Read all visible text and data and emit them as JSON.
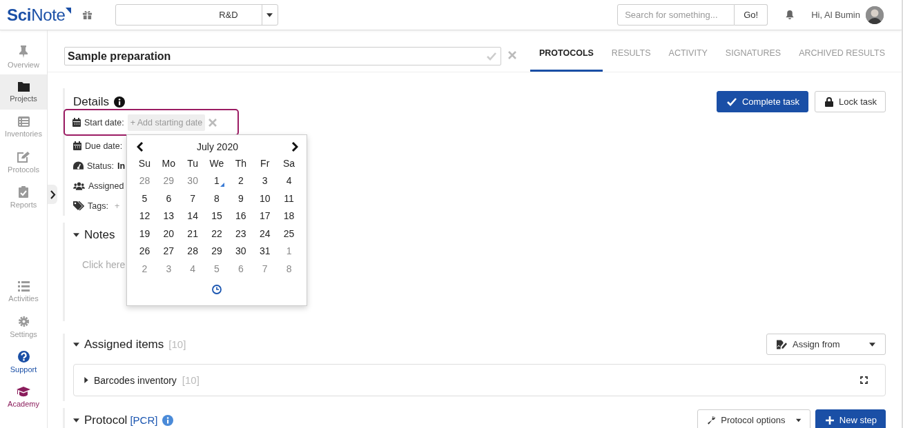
{
  "header": {
    "logo": "**Sci**Note",
    "team": "R&D",
    "search": {
      "placeholder": "Search for something...",
      "button": "Go!"
    },
    "greeting": "Hi, Al Bumin"
  },
  "sidebar": {
    "items": [
      {
        "label": "Overview",
        "selected": false,
        "color": "#9a9a9a"
      },
      {
        "label": "Projects",
        "selected": true,
        "color": "#555555"
      },
      {
        "label": "Inventories",
        "selected": false,
        "color": "#9a9a9a"
      },
      {
        "label": "Protocols",
        "selected": false,
        "color": "#9a9a9a"
      },
      {
        "label": "Reports",
        "selected": false,
        "color": "#9a9a9a"
      }
    ],
    "bottom_items": [
      {
        "label": "Activities",
        "selected": false,
        "color": "#9a9a9a"
      },
      {
        "label": "Settings",
        "selected": false,
        "color": "#9a9a9a"
      },
      {
        "label": "Support",
        "selected": false,
        "color": "#1a4fa6"
      },
      {
        "label": "Academy",
        "selected": false,
        "color": "#8b1d5c"
      }
    ]
  },
  "task": {
    "title": "Sample preparation",
    "tabs": [
      {
        "label": "PROTOCOLS",
        "selected": true
      },
      {
        "label": "RESULTS",
        "selected": false
      },
      {
        "label": "ACTIVITY",
        "selected": false
      },
      {
        "label": "SIGNATURES",
        "selected": false
      },
      {
        "label": "ARCHIVED RESULTS",
        "selected": false
      }
    ]
  },
  "details": {
    "heading": "Details",
    "buttons": [
      {
        "label": "Complete task",
        "kind": "primary"
      },
      {
        "label": "Lock task",
        "kind": "default"
      }
    ],
    "fields": [
      {
        "label": "Start date:",
        "value": "+ Add starting date",
        "kind": "chip",
        "highlighted": true
      },
      {
        "label": "Due date:",
        "kind": "plain",
        "highlighted": false
      },
      {
        "label": "Status:",
        "value": "In",
        "kind": "plain",
        "highlighted": false
      },
      {
        "label": "Assigned",
        "kind": "plain",
        "highlighted": false
      },
      {
        "label": "Tags:",
        "value": "+",
        "kind": "add",
        "highlighted": false
      }
    ]
  },
  "datepicker": {
    "month": "July 2020",
    "weekdays": [
      "Su",
      "Mo",
      "Tu",
      "We",
      "Th",
      "Fr",
      "Sa"
    ],
    "days": [
      {
        "label": "28",
        "other_month": true,
        "today": false
      },
      {
        "label": "29",
        "other_month": true,
        "today": false
      },
      {
        "label": "30",
        "other_month": true,
        "today": false
      },
      {
        "label": "1",
        "other_month": false,
        "today": true
      },
      {
        "label": "2",
        "other_month": false,
        "today": false
      },
      {
        "label": "3",
        "other_month": false,
        "today": false
      },
      {
        "label": "4",
        "other_month": false,
        "today": false
      },
      {
        "label": "5",
        "other_month": false,
        "today": false
      },
      {
        "label": "6",
        "other_month": false,
        "today": false
      },
      {
        "label": "7",
        "other_month": false,
        "today": false
      },
      {
        "label": "8",
        "other_month": false,
        "today": false
      },
      {
        "label": "9",
        "other_month": false,
        "today": false
      },
      {
        "label": "10",
        "other_month": false,
        "today": false
      },
      {
        "label": "11",
        "other_month": false,
        "today": false
      },
      {
        "label": "12",
        "other_month": false,
        "today": false
      },
      {
        "label": "13",
        "other_month": false,
        "today": false
      },
      {
        "label": "14",
        "other_month": false,
        "today": false
      },
      {
        "label": "15",
        "other_month": false,
        "today": false
      },
      {
        "label": "16",
        "other_month": false,
        "today": false
      },
      {
        "label": "17",
        "other_month": false,
        "today": false
      },
      {
        "label": "18",
        "other_month": false,
        "today": false
      },
      {
        "label": "19",
        "other_month": false,
        "today": false
      },
      {
        "label": "20",
        "other_month": false,
        "today": false
      },
      {
        "label": "21",
        "other_month": false,
        "today": false
      },
      {
        "label": "22",
        "other_month": false,
        "today": false
      },
      {
        "label": "23",
        "other_month": false,
        "today": false
      },
      {
        "label": "24",
        "other_month": false,
        "today": false
      },
      {
        "label": "25",
        "other_month": false,
        "today": false
      },
      {
        "label": "26",
        "other_month": false,
        "today": false
      },
      {
        "label": "27",
        "other_month": false,
        "today": false
      },
      {
        "label": "28",
        "other_month": false,
        "today": false
      },
      {
        "label": "29",
        "other_month": false,
        "today": false
      },
      {
        "label": "30",
        "other_month": false,
        "today": false
      },
      {
        "label": "31",
        "other_month": false,
        "today": false
      },
      {
        "label": "1",
        "other_month": true,
        "today": false
      },
      {
        "label": "2",
        "other_month": true,
        "today": false
      },
      {
        "label": "3",
        "other_month": true,
        "today": false
      },
      {
        "label": "4",
        "other_month": true,
        "today": false
      },
      {
        "label": "5",
        "other_month": true,
        "today": false
      },
      {
        "label": "6",
        "other_month": true,
        "today": false
      },
      {
        "label": "7",
        "other_month": true,
        "today": false
      },
      {
        "label": "8",
        "other_month": true,
        "today": false
      }
    ]
  },
  "notes": {
    "heading": "Notes",
    "expanded": true,
    "prompt": "Click here"
  },
  "assigned_items": {
    "heading": "Assigned items",
    "expanded": true,
    "count": "[10]",
    "button": "Assign from",
    "inventories": [
      {
        "name": "Barcodes inventory",
        "count": "[10]",
        "expanded": false
      }
    ]
  },
  "protocol": {
    "heading": "Protocol",
    "expanded": true,
    "name": "[PCR]",
    "buttons": [
      {
        "label": "Protocol options",
        "kind": "dropdown"
      },
      {
        "label": "New step",
        "kind": "primary"
      }
    ]
  }
}
